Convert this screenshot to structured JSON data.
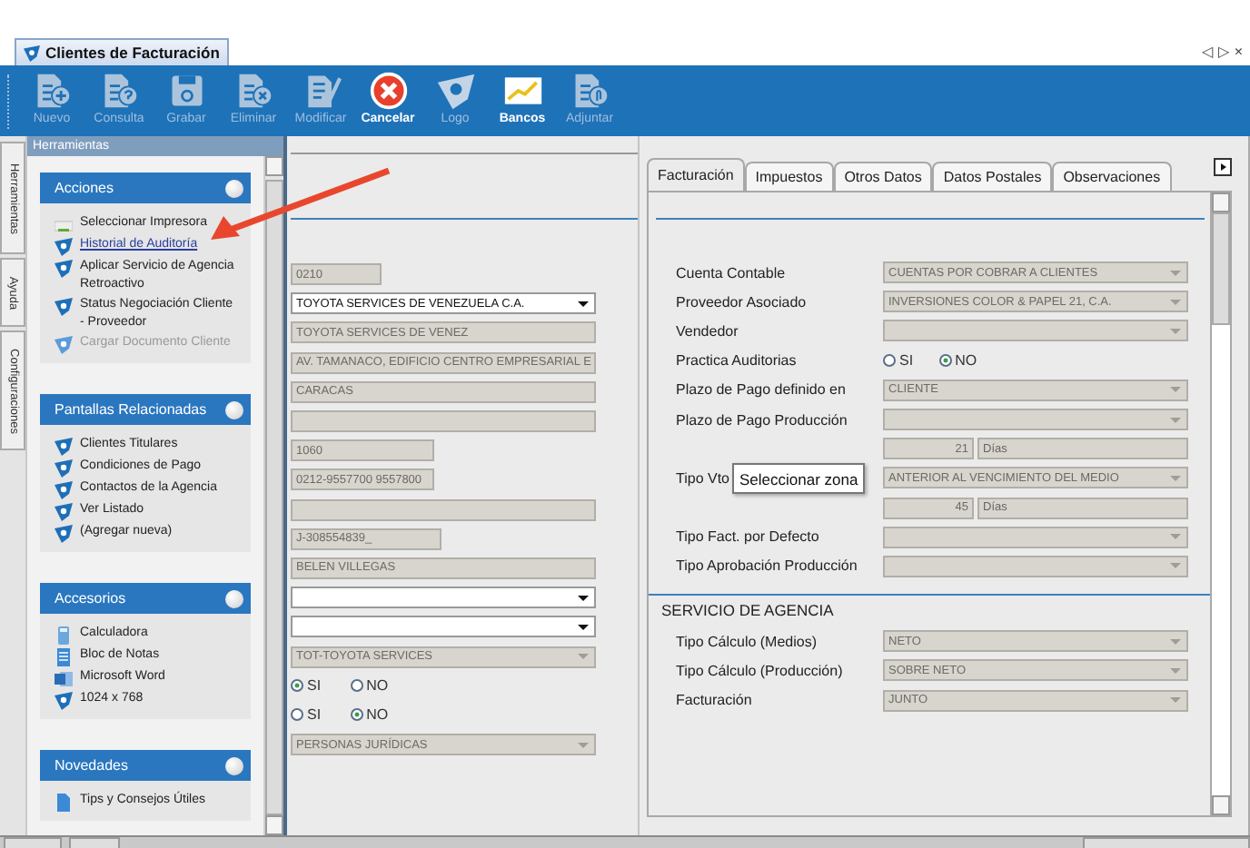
{
  "window_tab": {
    "title": "Clientes de Facturación"
  },
  "window_controls": [
    "◁",
    "▷",
    "×"
  ],
  "toolbar": [
    {
      "label": "Nuevo",
      "kind": "new",
      "disabled": true
    },
    {
      "label": "Consulta",
      "kind": "query",
      "disabled": true
    },
    {
      "label": "Grabar",
      "kind": "save",
      "disabled": true
    },
    {
      "label": "Eliminar",
      "kind": "delete",
      "disabled": true
    },
    {
      "label": "Modificar",
      "kind": "edit",
      "disabled": true
    },
    {
      "label": "Cancelar",
      "kind": "cancel",
      "disabled": false
    },
    {
      "label": "Logo",
      "kind": "logo",
      "disabled": true
    },
    {
      "label": "Bancos",
      "kind": "banks",
      "disabled": false
    },
    {
      "label": "Adjuntar",
      "kind": "attach",
      "disabled": true
    }
  ],
  "side_tabs": [
    "Herramientas",
    "Ayuda",
    "Configuraciones"
  ],
  "tools_panel": {
    "title": "Herramientas",
    "groups": [
      {
        "title": "Acciones",
        "items": [
          {
            "label": "Seleccionar Impresora",
            "kind": "printer",
            "link": false,
            "disabled": false
          },
          {
            "label": "Historial de Auditoría",
            "kind": "shield",
            "link": true,
            "disabled": false
          },
          {
            "label": "Aplicar Servicio de Agencia Retroactivo",
            "kind": "shield",
            "link": false,
            "disabled": false
          },
          {
            "label": "Status Negociación Cliente - Proveedor",
            "kind": "shield",
            "link": false,
            "disabled": false
          },
          {
            "label": "Cargar Documento Cliente",
            "kind": "shield",
            "link": false,
            "disabled": true
          }
        ]
      },
      {
        "title": "Pantallas Relacionadas",
        "items": [
          {
            "label": "Clientes Titulares",
            "kind": "shield",
            "link": false,
            "disabled": false
          },
          {
            "label": "Condiciones de Pago",
            "kind": "shield",
            "link": false,
            "disabled": false
          },
          {
            "label": "Contactos de la Agencia",
            "kind": "shield",
            "link": false,
            "disabled": false
          },
          {
            "label": "Ver Listado",
            "kind": "shield",
            "link": false,
            "disabled": false
          },
          {
            "label": "(Agregar nueva)",
            "kind": "shield",
            "link": false,
            "disabled": false
          }
        ]
      },
      {
        "title": "Accesorios",
        "items": [
          {
            "label": "Calculadora",
            "kind": "calculator",
            "link": false,
            "disabled": false
          },
          {
            "label": "Bloc de Notas",
            "kind": "notepad",
            "link": false,
            "disabled": false
          },
          {
            "label": "Microsoft Word",
            "kind": "word",
            "link": false,
            "disabled": false
          },
          {
            "label": "1024 x 768",
            "kind": "shield",
            "link": false,
            "disabled": false
          }
        ]
      },
      {
        "title": "Novedades",
        "items": [
          {
            "label": "Tips y Consejos Útiles",
            "kind": "document",
            "link": false,
            "disabled": false
          }
        ]
      }
    ]
  },
  "form": {
    "fields": [
      {
        "kind": "text",
        "value": "0210",
        "disabled": true
      },
      {
        "kind": "select",
        "value": "TOYOTA SERVICES DE VENEZUELA C.A.",
        "disabled": false
      },
      {
        "kind": "text",
        "value": "TOYOTA SERVICES DE VENEZ",
        "disabled": true
      },
      {
        "kind": "text",
        "value": "AV. TAMANACO, EDIFICIO CENTRO EMPRESARIAL E",
        "disabled": true
      },
      {
        "kind": "text",
        "value": "CARACAS",
        "disabled": true
      },
      {
        "kind": "text",
        "disabled": true
      },
      {
        "kind": "text",
        "value": "1060",
        "disabled": true
      },
      {
        "kind": "text",
        "value": "0212-9557700 9557800",
        "disabled": true
      },
      {
        "kind": "text",
        "disabled": true
      },
      {
        "kind": "text",
        "value": "J-308554839_",
        "disabled": true
      },
      {
        "kind": "text",
        "value": "BELEN VILLEGAS",
        "disabled": true
      },
      {
        "kind": "select",
        "disabled": false
      },
      {
        "kind": "select",
        "disabled": false
      },
      {
        "kind": "select",
        "value": "TOT-TOYOTA SERVICES",
        "disabled": true
      },
      {
        "kind": "radio",
        "options": [
          {
            "label": "SI",
            "selected": true
          },
          {
            "label": "NO",
            "selected": false
          }
        ]
      },
      {
        "kind": "radio",
        "options": [
          {
            "label": "SI",
            "selected": false
          },
          {
            "label": "NO",
            "selected": true
          }
        ]
      },
      {
        "kind": "select",
        "value": "PERSONAS JURÍDICAS",
        "disabled": true
      }
    ]
  },
  "detail_tabs": [
    {
      "label": "Facturación",
      "selected": true
    },
    {
      "label": "Impuestos",
      "selected": false
    },
    {
      "label": "Otros Datos",
      "selected": false
    },
    {
      "label": "Datos Postales",
      "selected": false
    },
    {
      "label": "Observaciones",
      "selected": false
    }
  ],
  "facturacion": {
    "rows": [
      {
        "label": "Cuenta Contable",
        "kind": "select",
        "value": "CUENTAS POR COBRAR A CLIENTES"
      },
      {
        "label": "Proveedor Asociado",
        "kind": "select",
        "value": "INVERSIONES COLOR & PAPEL 21, C.A."
      },
      {
        "label": "Vendedor",
        "kind": "select"
      },
      {
        "label": "Practica Auditorias",
        "kind": "radio",
        "options": [
          {
            "label": "SI",
            "selected": false
          },
          {
            "label": "NO",
            "selected": true
          }
        ]
      },
      {
        "label": "Plazo de Pago definido en",
        "kind": "select",
        "value": "CLIENTE"
      },
      {
        "label": "Plazo de Pago Producción",
        "kind": "select"
      },
      {
        "kind": "days",
        "value": "21",
        "unit": "Días"
      },
      {
        "label": "Tipo Vto",
        "kind": "select",
        "value": "ANTERIOR AL VENCIMIENTO DEL MEDIO",
        "tooltip": "Seleccionar zona"
      },
      {
        "kind": "days",
        "value": "45",
        "unit": "Días"
      },
      {
        "label": "Tipo Fact. por Defecto",
        "kind": "select"
      },
      {
        "label": "Tipo Aprobación Producción",
        "kind": "select"
      }
    ],
    "section": {
      "title": "SERVICIO DE AGENCIA",
      "rows": [
        {
          "label": "Tipo Cálculo (Medios)",
          "kind": "select",
          "value": "NETO"
        },
        {
          "label": "Tipo Cálculo (Producción)",
          "kind": "select",
          "value": "SOBRE NETO"
        },
        {
          "label": "Facturación",
          "kind": "select",
          "value": "JUNTO"
        }
      ]
    }
  }
}
